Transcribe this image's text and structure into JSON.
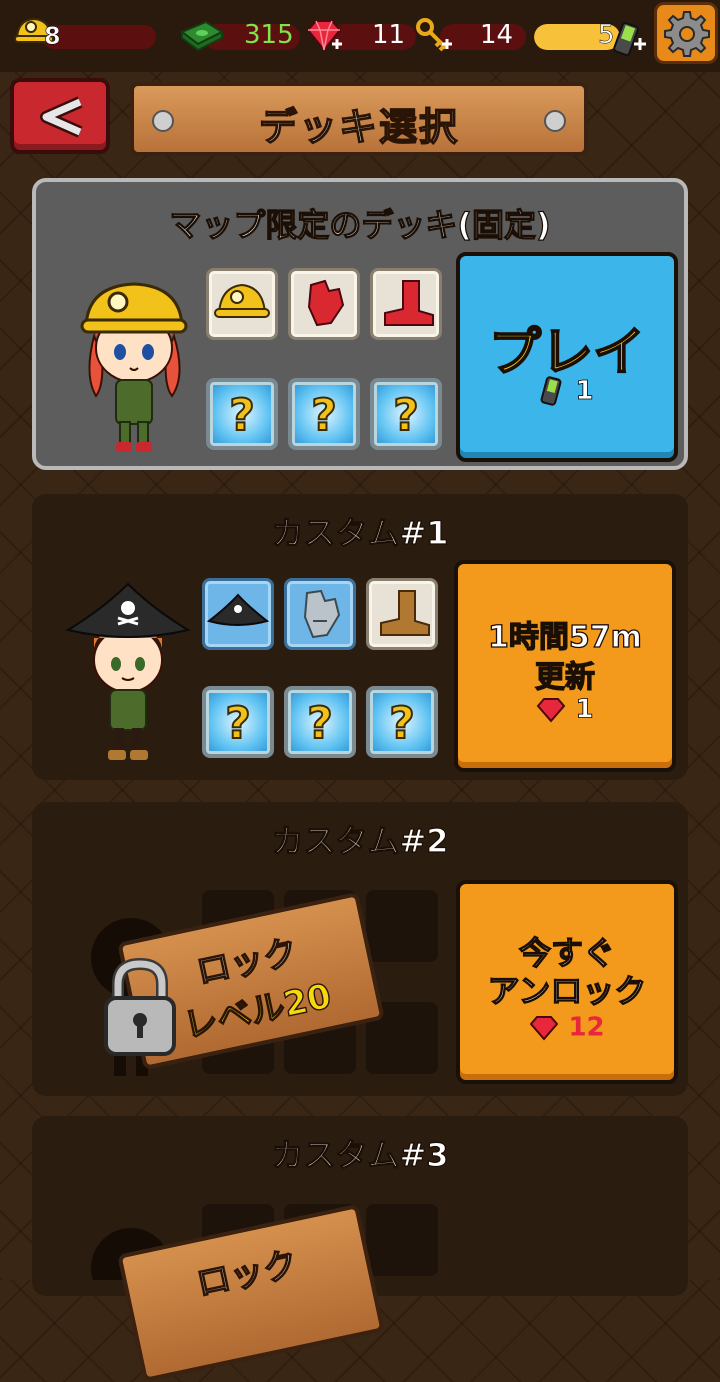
{
  "status": {
    "level": "8",
    "money": "315",
    "gems": "11",
    "keys": "14",
    "energy": "5",
    "energy_fill_fraction": 1.0
  },
  "header": {
    "title": "デッキ選択"
  },
  "decks": [
    {
      "title": "マップ限定のデッキ(固定)",
      "character": "miner-girl",
      "equipment": [
        "yellow-miner-helmet-icon",
        "red-glove-icon",
        "red-boot-icon"
      ],
      "bonus_slots": [
        "question-mark",
        "question-mark",
        "question-mark"
      ],
      "button_label": "プレイ",
      "cost_value": "1",
      "cost_icon": "battery-icon"
    },
    {
      "title": "カスタム#1",
      "character": "pirate-boy",
      "equipment": [
        "pirate-hat-icon",
        "steel-glove-icon",
        "brown-boot-icon"
      ],
      "bonus_slots": [
        "question-mark",
        "question-mark",
        "question-mark"
      ],
      "button_label_line1": "1時間57m",
      "button_label_line2": "更新",
      "cost_value": "1",
      "cost_icon": "gem-icon"
    },
    {
      "title": "カスタム#2",
      "lock_word": "ロック",
      "lock_level": "レベル20",
      "button_label_line1": "今すぐ",
      "button_label_line2": "アンロック",
      "cost_value": "12",
      "cost_icon": "gem-icon"
    },
    {
      "title": "カスタム#3",
      "lock_word": "ロック"
    }
  ],
  "colors": {
    "play_button": "#3cb6ea",
    "orange_button": "#f39a1d",
    "gem": "#e8263c",
    "energy": "#f7c13a",
    "money_text": "#7fe34a"
  }
}
